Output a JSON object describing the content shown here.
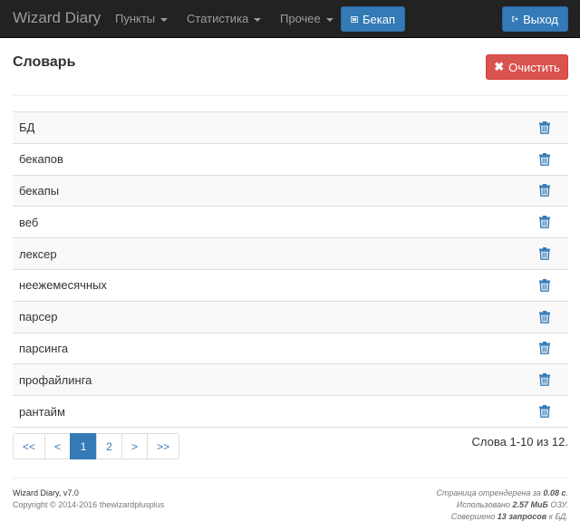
{
  "navbar": {
    "brand": "Wizard Diary",
    "menu": [
      {
        "label": "Пункты"
      },
      {
        "label": "Статистика"
      },
      {
        "label": "Прочее"
      }
    ],
    "backup_label": "Бекап",
    "logout_label": "Выход"
  },
  "page": {
    "title": "Словарь",
    "clear_label": "Очистить"
  },
  "words": [
    {
      "text": "БД"
    },
    {
      "text": "бекапов"
    },
    {
      "text": "бекапы"
    },
    {
      "text": "веб"
    },
    {
      "text": "лексер"
    },
    {
      "text": "неежемесячных"
    },
    {
      "text": "парсер"
    },
    {
      "text": "парсинга"
    },
    {
      "text": "профайлинга"
    },
    {
      "text": "рантайм"
    }
  ],
  "pagination": {
    "first": "<<",
    "prev": "<",
    "pages": [
      "1",
      "2"
    ],
    "current": "1",
    "next": ">",
    "last": ">>"
  },
  "count_text": "Слова 1-10 из 12.",
  "footer": {
    "app_version": "Wizard Diary, v7.0",
    "copyright": "Copyright © 2014-2016 thewizardplusplus",
    "render_prefix": "Страница отрендерена за ",
    "render_value": "0.08 с",
    "render_suffix": ".",
    "memory_prefix": "Использовано ",
    "memory_value": "2.57 МиБ",
    "memory_suffix": " ОЗУ.",
    "queries_prefix": "Совершено ",
    "queries_value": "13 запросов",
    "queries_suffix": " к БД."
  },
  "colors": {
    "navbar_bg": "#222222",
    "primary": "#337ab7",
    "danger": "#d9534f"
  },
  "icons": {
    "backup": "backup-icon",
    "logout": "logout-icon",
    "clear": "times-icon",
    "delete": "trash-icon"
  }
}
